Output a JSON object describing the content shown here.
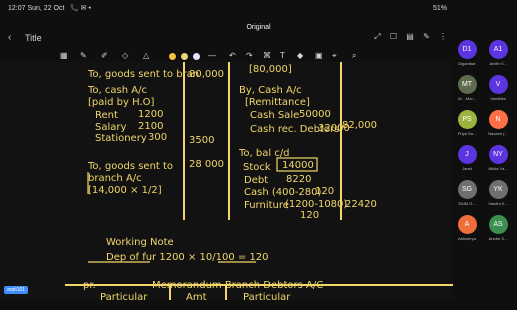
{
  "status": {
    "time": "12:07 Sun, 22 Oct",
    "right": "51%"
  },
  "document": {
    "label": "Original"
  },
  "app": {
    "title": "Title"
  },
  "toolbar": {
    "colors": [
      "#f2c23a",
      "#e7d76f",
      "#e9e2ff"
    ]
  },
  "participants": [
    {
      "initials": "D1",
      "name": "Digambar",
      "color": "#5b36e0"
    },
    {
      "initials": "A1",
      "name": "Amith V...",
      "color": "#5b36e0"
    },
    {
      "initials": "MT",
      "name": "M... Mor...",
      "color": "#5e6b4e"
    },
    {
      "initials": "V",
      "name": "Vandhita",
      "color": "#5b36e0"
    },
    {
      "initials": "PS",
      "name": "Priya Sa...",
      "color": "#9bb33f"
    },
    {
      "initials": "N",
      "name": "Naveen (...",
      "color": "#ff6f45"
    },
    {
      "initials": "J",
      "name": "Janet",
      "color": "#5b36e0"
    },
    {
      "initials": "NY",
      "name": "Nikita Ya...",
      "color": "#5b36e0"
    },
    {
      "initials": "SG",
      "name": "SAIM G...",
      "color": "#6f6f6f"
    },
    {
      "initials": "YK",
      "name": "Vandhi K...",
      "color": "#6f6f6f"
    },
    {
      "initials": "A",
      "name": "Abhishrya",
      "color": "#f06e3a"
    },
    {
      "initials": "AS",
      "name": "Anubh S...",
      "color": "#3b8f50"
    }
  ],
  "notes": {
    "left1": "To, goods sent to bran",
    "left1_val": "80,000",
    "left2": "To, cash A/c",
    "left3": "[paid by H.O]",
    "left4": "Rent",
    "left4_val": "1200",
    "left5": "Salary",
    "left5_val": "2100",
    "left6": "Stationery",
    "left6_val": "300",
    "left_total": "3500",
    "left7": "To, goods sent to",
    "left7_val": "28 000",
    "left8": "branch A/c",
    "left9": "[14,000 × 1/2]",
    "right1": "[80,000]",
    "right2": "By, Cash A/c",
    "right3": "[Remittance]",
    "right4": "Cash Sale",
    "right4_val": "50000",
    "right5": "Cash rec. Debtors",
    "right5_val": "32000",
    "right_total": "82,000",
    "right6": "To, bal c/d",
    "right7": "Stock",
    "right7_val": "14000",
    "right8": "Debt",
    "right8_val": "8220",
    "right9": "Cash (400-280)",
    "right9_val": "120",
    "right10": "Furniture",
    "right10_val": "(1200-1080)",
    "right10_total": "22420",
    "right10_sub": "120",
    "wn_title": "Working Note",
    "wn_text": "Dep of fur   1200 × 10/100 = 120",
    "bottom1": "pr.",
    "bottom2": "Memorandum Branch Debtors A/C",
    "bottom3": "Particular",
    "bottom4": "Amt",
    "bottom5": "Particular"
  },
  "footer": {
    "chip": "arpit101"
  }
}
